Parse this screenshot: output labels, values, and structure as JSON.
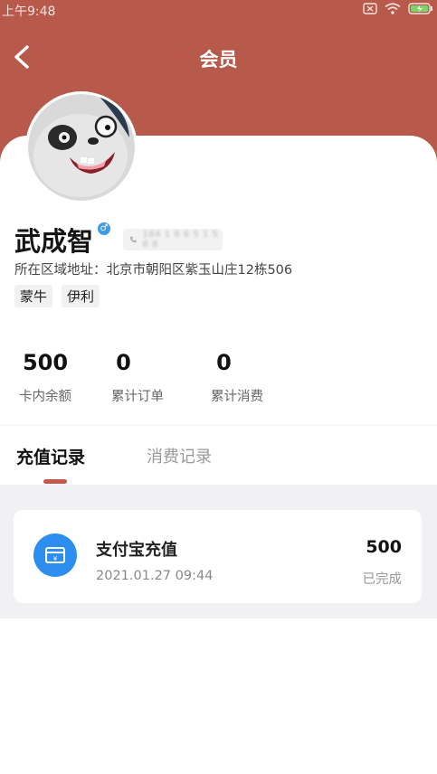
{
  "status_bar": {
    "time": "上午9:48"
  },
  "nav": {
    "title": "会员"
  },
  "profile": {
    "name": "武成智",
    "gender_symbol": "♂",
    "phone_masked": "184 1 8 6 5 1 5 8 8",
    "address": "所在区域地址：北京市朝阳区紫玉山庄12栋506",
    "tags": [
      "蒙牛",
      "伊利"
    ]
  },
  "stats": [
    {
      "value": "500",
      "label": "卡内余额"
    },
    {
      "value": "0",
      "label": "累计订单"
    },
    {
      "value": "0",
      "label": "累计消费"
    }
  ],
  "tabs": [
    {
      "label": "充值记录",
      "active": true
    },
    {
      "label": "消费记录",
      "active": false
    }
  ],
  "records": [
    {
      "title": "支付宝充值",
      "datetime": "2021.01.27 09:44",
      "amount": "500",
      "status": "已完成",
      "icon": "alipay-wallet-icon"
    }
  ],
  "colors": {
    "brand": "#b85a4b",
    "indicator": "#c4584a",
    "alipay": "#2d8ef0",
    "gender": "#3b9ce6"
  }
}
